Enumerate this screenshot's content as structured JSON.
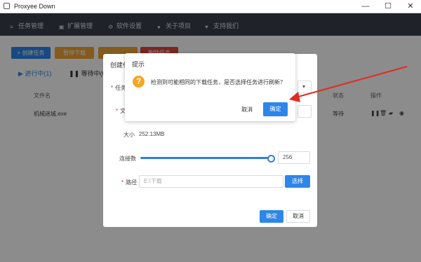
{
  "window": {
    "title": "Proxyee Down",
    "minimize": "—",
    "maximize": "☐",
    "close": "✕"
  },
  "nav": {
    "items": [
      "任务管理",
      "扩展管理",
      "软件设置",
      "关于项目",
      "支持我们"
    ]
  },
  "toolbar": {
    "create": "+ 创建任务",
    "btn2": "暂停下载",
    "btn3": "",
    "btn4": "删除任务"
  },
  "tabs": {
    "active": "进行中(1)",
    "paused": "等待中(0)"
  },
  "table": {
    "headers": {
      "name": "文件名",
      "status": "状态",
      "ops": "操作"
    },
    "row": {
      "name": "机械迷城.exe",
      "status": "等待"
    }
  },
  "create_dialog": {
    "title": "创建任务",
    "task_label": "任务",
    "file_label": "文件名",
    "size_label": "大小",
    "size_value": "252.13MB",
    "conn_label": "连接数",
    "conn_value": "256",
    "path_label": "路径",
    "path_placeholder": "E:\\下载",
    "choose_label": "选择",
    "confirm_label": "确定",
    "cancel_label": "取消"
  },
  "confirm_dialog": {
    "title": "提示",
    "message": "检测到可能相同的下载任务，是否选择任务进行刷新？",
    "cancel": "取消",
    "ok": "确定"
  },
  "colors": {
    "accent": "#2d86ea",
    "warning": "#f5a623",
    "nav_bg": "#3a3f4a",
    "annotation_arrow": "#e02b20"
  }
}
